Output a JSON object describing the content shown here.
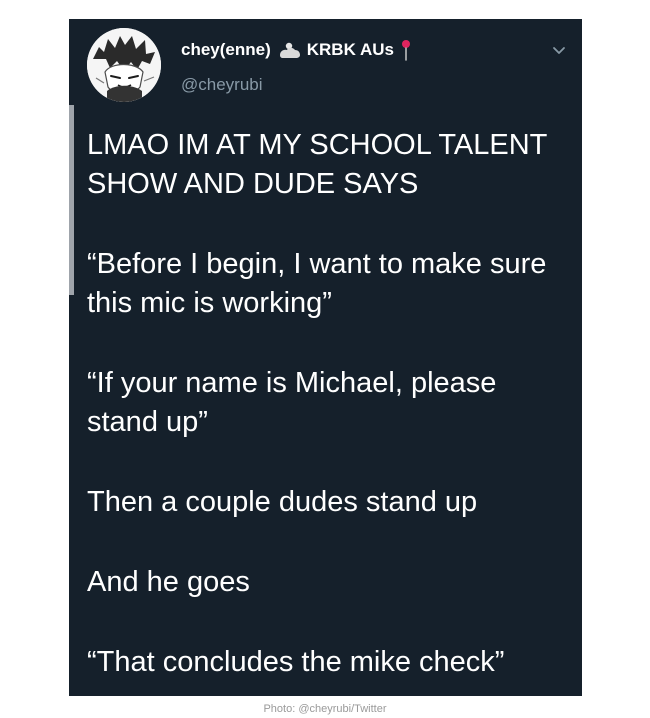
{
  "tweet": {
    "display_name": "chey(enne)",
    "name_suffix": "KRBK AUs",
    "handle": "@cheyrubi",
    "avatar_icon": "anime-avatar-icon",
    "cloud_icon": "cloud-person-icon",
    "pin_icon": "red-pushpin-icon",
    "menu_icon": "chevron-down-icon",
    "paragraphs": [
      "LMAO IM AT MY SCHOOL TALENT SHOW AND DUDE SAYS",
      "“Before I begin, I want to make sure this mic is working”",
      "“If your name is Michael, please stand up”",
      "Then a couple dudes stand up",
      "And he goes",
      "“That concludes the mike check”"
    ]
  },
  "credit": "Photo: @cheyrubi/Twitter",
  "colors": {
    "background": "#15202b",
    "text": "#ffffff",
    "handle": "#8899a6",
    "pin": "#e0245e",
    "credit": "#9a9a9a"
  }
}
